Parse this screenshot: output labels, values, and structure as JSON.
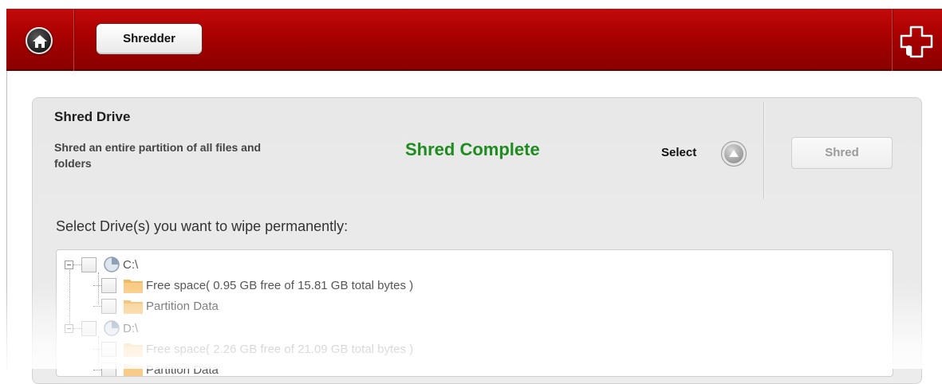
{
  "header": {
    "home_icon": "home-icon",
    "tab_label": "Shredder",
    "brand_icon": "puzzle-plus-icon"
  },
  "panel": {
    "title": "Shred Drive",
    "description": "Shred an entire partition of all files and folders",
    "status": "Shred Complete",
    "status_color": "#1e8c1e",
    "select_label": "Select",
    "select_icon": "chevron-up-icon",
    "shred_label": "Shred",
    "prompt": "Select Drive(s) you want to wipe permanently:"
  },
  "tree": {
    "drives": [
      {
        "label": "C:\\",
        "children": [
          {
            "label": "Free space( 0.95 GB free of 15.81 GB total bytes )"
          },
          {
            "label": "Partition Data"
          }
        ]
      },
      {
        "label": "D:\\",
        "children": [
          {
            "label": "Free space( 2.26 GB free of 21.09 GB total bytes )"
          },
          {
            "label": "Partition Data"
          }
        ]
      }
    ]
  },
  "colors": {
    "header_red": "#a80000",
    "folder_orange": "#f4b860"
  }
}
